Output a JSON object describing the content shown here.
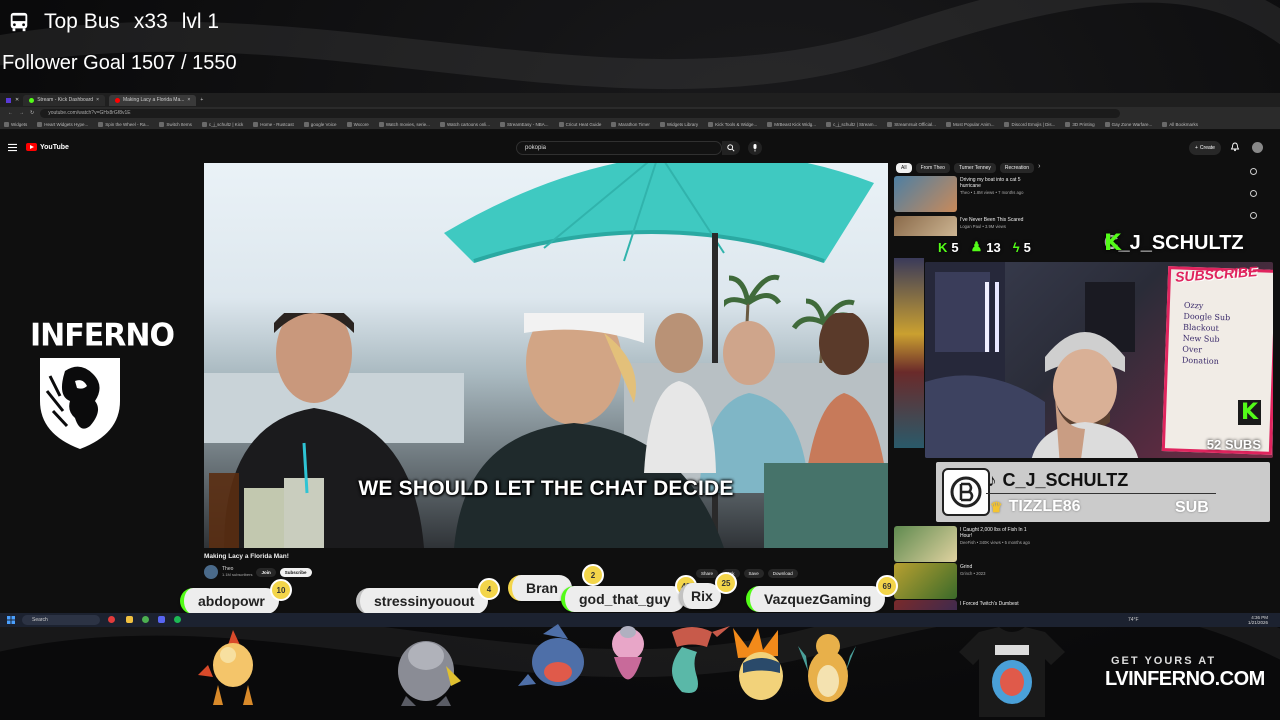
{
  "overlay": {
    "top_bus_label": "Top Bus",
    "top_bus_multiplier": "x33",
    "top_bus_level": "lvl 1",
    "follower_goal": "Follower Goal 1507 / 1550"
  },
  "browser": {
    "tabs": [
      {
        "label": "Stream - Kick Dashboard",
        "color": "#53fc18"
      },
      {
        "label": "Making Lacy a Florida Ma...",
        "color": "#ff0000"
      }
    ],
    "url": "youtube.com/watch?v=GHx8rGf8v1E",
    "bookmarks": [
      "Widgets",
      "Heart Widgets Hype...",
      "Spin the Wheel - Ra...",
      "Switch Items",
      "c_j_schultz | Kick",
      "Home - Rustcast",
      "google Voice",
      "Wxcore",
      "Watch movies, serie...",
      "Watch cartoons onli...",
      "StreamEasy - NBA...",
      "Cricut Heat Guide",
      "Marathon Timer",
      "Widgets Library",
      "Kick Tools & Widge...",
      "MrBeast Kick Widg...",
      "c_j_schultz | Stream...",
      "Streamrsuit Official...",
      "Most Popular Anim...",
      "Discord Emojis | Dis...",
      "3D Printing",
      "Gay Zone Warfare...",
      "All Bookmarks"
    ]
  },
  "youtube": {
    "logo": "YouTube",
    "search_value": "pokopia",
    "create_label": "Create",
    "video_title": "Making Lacy a Florida Man!",
    "channel_name": "Theo",
    "channel_subs": "1.1M subscribers",
    "subscribe_label": "Subscribe",
    "join_label": "Join",
    "subtitle": "WE SHOULD LET THE CHAT DECIDE",
    "actions": [
      "Share",
      "Ask",
      "Save",
      "Download"
    ],
    "chips": [
      {
        "label": "All",
        "active": true
      },
      {
        "label": "From Theo",
        "active": false
      },
      {
        "label": "Turner Tenney",
        "active": false
      },
      {
        "label": "Recreation",
        "active": false
      }
    ],
    "recommendations": [
      {
        "title": "Driving my boat into a cat 5 hurricane",
        "meta": "Theo • 1.8M views • 7 months ago",
        "color": "#4d7fa3"
      },
      {
        "title": "I've Never Been This Scared",
        "meta": "Logan Paul • 3.9M views",
        "color": "#8a6a4a"
      },
      {
        "title": "I Caught 2,000 lbs of Fish In 1 Hour!",
        "meta": "DeeFish • 340K views • 5 months ago",
        "color": "#5f8a4f"
      },
      {
        "title": "Grind",
        "meta": "Grinch • 2023",
        "color": "#b8a030"
      },
      {
        "title": "I Forced Twitch's Dumbest",
        "meta": "",
        "color": "#7a2a2a"
      }
    ]
  },
  "stream": {
    "kick_subs": "5",
    "followers_icon_count": "13",
    "extra_count": "5",
    "streamer": "C_J_SCHULTZ",
    "cam_subs": "52 SUBS",
    "cam_subscribe": "SUBSCRIBE",
    "board_text": "Ozzy\nDoogle Sub\nBlackout\nNew Sub\nOver\nDonation"
  },
  "sub_alert": {
    "user": "C_J_SCHULTZ",
    "gifter": "TIZZLE86",
    "type": "SUB"
  },
  "inferno_logo": "INFERNO",
  "chat_bubbles": [
    {
      "name": "abdopowr",
      "badge": "10"
    },
    {
      "name": "stressinyouout",
      "badge": "4"
    },
    {
      "name": "Bran",
      "badge": "2"
    },
    {
      "name": "god_that_guy",
      "badge": "48"
    },
    {
      "name": "Rix",
      "badge": "25"
    },
    {
      "name": "VazquezGaming",
      "badge": "69"
    }
  ],
  "taskbar": {
    "search_placeholder": "Search",
    "weather": "74°F",
    "time": "4:36 PM",
    "date": "1/21/2026"
  },
  "merch": {
    "get_yours": "GET YOURS AT",
    "site": "LVINFERNO.COM"
  },
  "colors": {
    "kick_green": "#53fc18",
    "yt_red": "#ff0000",
    "badge_gold": "#f3d54a"
  }
}
